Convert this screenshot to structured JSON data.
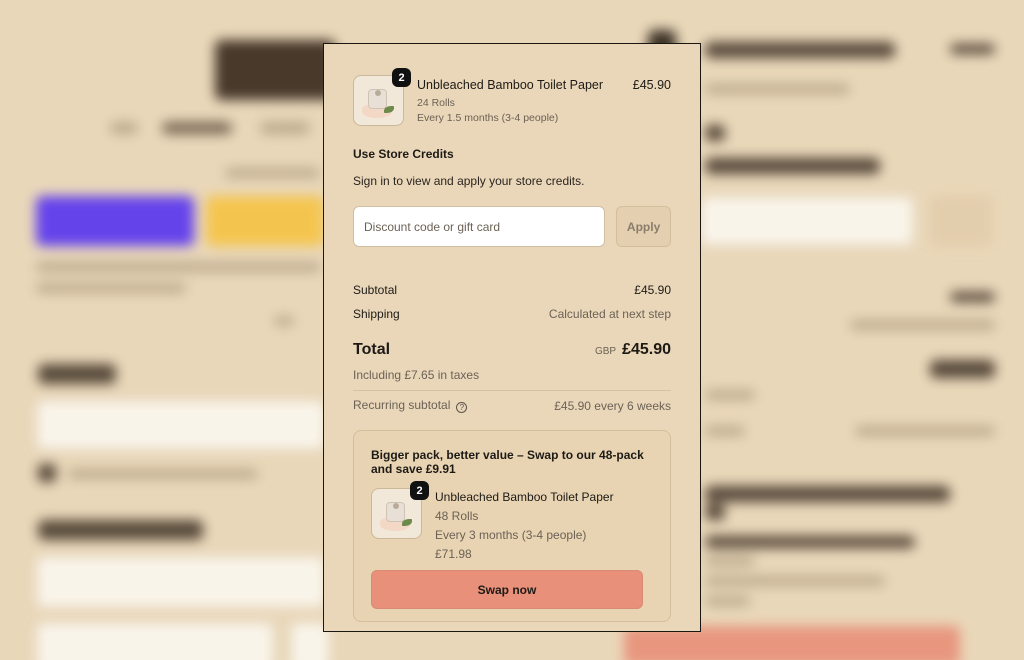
{
  "cart_item": {
    "quantity": "2",
    "name": "Unbleached Bamboo Toilet Paper",
    "variant": "24 Rolls",
    "frequency": "Every 1.5 months (3-4 people)",
    "price": "£45.90"
  },
  "store_credits": {
    "title": "Use Store Credits",
    "text": "Sign in to view and apply your store credits."
  },
  "discount": {
    "placeholder": "Discount code or gift card",
    "apply_label": "Apply"
  },
  "summary": {
    "subtotal_label": "Subtotal",
    "subtotal_value": "£45.90",
    "shipping_label": "Shipping",
    "shipping_value": "Calculated at next step",
    "total_label": "Total",
    "currency": "GBP",
    "total_value": "£45.90",
    "tax_note": "Including £7.65 in taxes",
    "recurring_label": "Recurring subtotal",
    "recurring_value": "£45.90 every 6 weeks"
  },
  "upsell": {
    "title": "Bigger pack, better value – Swap to our 48-pack and save £9.91",
    "quantity": "2",
    "name": "Unbleached Bamboo Toilet Paper",
    "variant": "48 Rolls",
    "frequency": "Every 3 months (3-4 people)",
    "price": "£71.98",
    "button_label": "Swap now"
  },
  "colors": {
    "panel_bg": "#ead7b9",
    "swap_button": "#e8907a",
    "badge": "#111111"
  },
  "icons": {
    "help": "question-circle-icon"
  }
}
